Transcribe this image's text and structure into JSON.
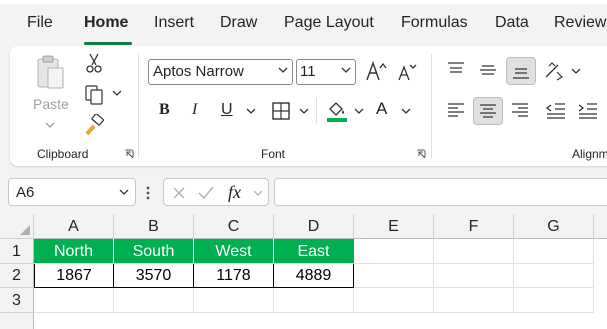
{
  "menu": {
    "tabs": [
      {
        "label": "File"
      },
      {
        "label": "Home"
      },
      {
        "label": "Insert"
      },
      {
        "label": "Draw"
      },
      {
        "label": "Page Layout"
      },
      {
        "label": "Formulas"
      },
      {
        "label": "Data"
      },
      {
        "label": "Review"
      }
    ],
    "active_tab": "Home",
    "accent_color": "#107c41"
  },
  "ribbon": {
    "clipboard": {
      "paste_label": "Paste",
      "group_label": "Clipboard",
      "icons": [
        "paste-icon",
        "cut-icon",
        "copy-icon",
        "format-painter-icon"
      ]
    },
    "font": {
      "font_name": "Aptos Narrow",
      "font_size": "11",
      "bold": "B",
      "italic": "I",
      "underline": "U",
      "font_color_label": "A",
      "fill_color": "#00b050",
      "group_label": "Font"
    },
    "alignment": {
      "group_label": "Alignm"
    }
  },
  "formula_bar": {
    "name_box": "A6",
    "fx_label": "fx",
    "formula": ""
  },
  "sheet": {
    "columns": [
      "A",
      "B",
      "C",
      "D",
      "E",
      "F",
      "G"
    ],
    "rows": [
      "1",
      "2",
      "3"
    ],
    "header_fill": "#00b050",
    "header_row": [
      "North",
      "South",
      "West",
      "East"
    ],
    "data_row": [
      "1867",
      "3570",
      "1178",
      "4889"
    ]
  }
}
